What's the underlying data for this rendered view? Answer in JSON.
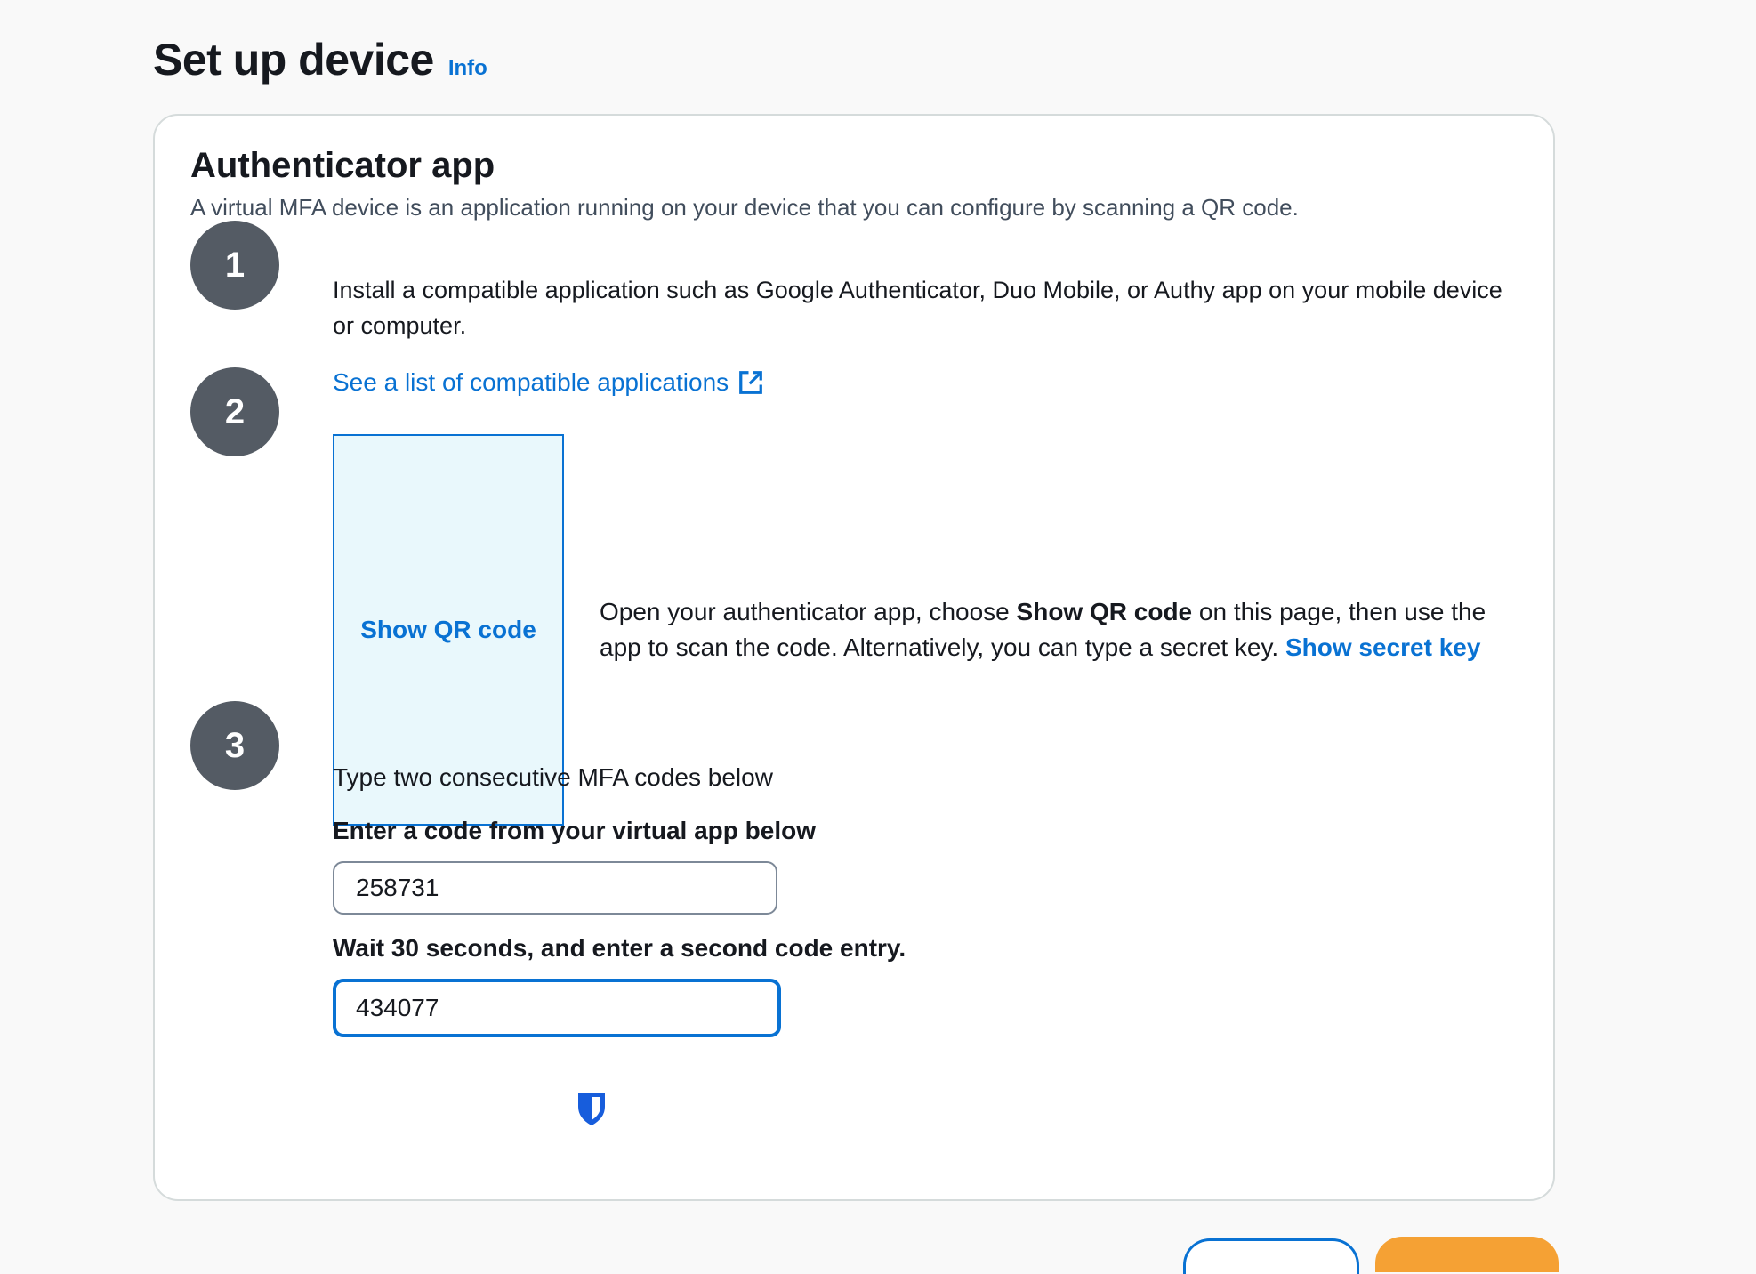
{
  "page": {
    "title": "Set up device",
    "info_link": "Info"
  },
  "card": {
    "title": "Authenticator app",
    "description": "A virtual MFA device is an application running on your device that you can configure by scanning a QR code."
  },
  "steps": [
    {
      "number": "1",
      "text": "Install a compatible application such as Google Authenticator, Duo Mobile, or Authy app on your mobile device or computer.",
      "link": "See a list of compatible applications"
    },
    {
      "number": "2",
      "qr_button": "Show QR code",
      "text_part1": "Open your authenticator app, choose ",
      "text_bold": "Show QR code",
      "text_part2": " on this page, then use the app to scan the code. Alternatively, you can type a secret key. ",
      "secret_link": "Show secret key"
    },
    {
      "number": "3",
      "title": "Type two consecutive MFA codes below",
      "field1_label": "Enter a code from your virtual app below",
      "field1_value": "258731",
      "field2_label": "Wait 30 seconds, and enter a second code entry.",
      "field2_value": "434077"
    }
  ],
  "colors": {
    "link": "#0972d3",
    "badge": "#545b64",
    "qr_background": "#e9f8fc",
    "primary_button": "#f5a134"
  },
  "icons": {
    "external_link": "external-link-icon",
    "password_manager": "bitwarden-shield-icon"
  }
}
